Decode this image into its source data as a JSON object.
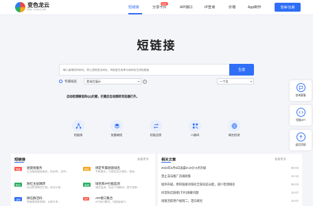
{
  "header": {
    "logo_name": "变色龙云",
    "logo_domain": "BSL.YUN.COM",
    "nav": [
      {
        "label": "短链接",
        "active": true
      },
      {
        "label": "分享卡片",
        "badge": "HOT"
      },
      {
        "label": "API接口"
      },
      {
        "label": "IP查询"
      },
      {
        "label": "价格"
      },
      {
        "label": "App制作"
      }
    ],
    "login_label": "登录/注册"
  },
  "hero": {
    "title": "短链接",
    "search_placeholder": "输入要缩短的网址，禁止违规违法网址，将批量生成单号或网址生成短链接",
    "generate_label": "生成",
    "option_label": "专属域名",
    "select_login_label": "登录后展示",
    "select_duration": "一个月",
    "help": "?",
    "notice": "自动检测微信和QQ拦截，拦截后自动跳转浏览器打开。"
  },
  "features": [
    {
      "label": "短链接",
      "icon": "share-icon"
    },
    {
      "label": "批量缩短",
      "icon": "layers-icon"
    },
    {
      "label": "短链还原",
      "icon": "swap-icon"
    },
    {
      "label": "二维码",
      "icon": "qrcode-icon"
    },
    {
      "label": "域名检测",
      "icon": "globe-icon"
    }
  ],
  "float_bar": [
    {
      "label": "咨询客服",
      "icon": "chat-icon"
    },
    {
      "label": "短链API",
      "icon": "code-icon"
    },
    {
      "label": "返回顶部",
      "icon": "arrow-up-icon"
    }
  ],
  "tools_panel": {
    "title": "短链接",
    "more": "查看更多",
    "items": [
      {
        "tag": "短链",
        "tag_color": "#ff5a4e",
        "title": "短链接服务",
        "desc": "企业级短链接服务，防封杀，支持..."
      },
      {
        "tag": "域名",
        "tag_color": "#f5a623",
        "title": "绑定专属短链域名",
        "desc": "专属域名，可绑定自主域名，提高..."
      },
      {
        "tag": "防封",
        "tag_color": "#27ae60",
        "title": "防红主层跳转",
        "desc": "自动检测微信拦截，安全可靠..."
      },
      {
        "tag": "监测",
        "tag_color": "#27ae60",
        "title": "域名和IP拦截监测",
        "desc": "域名监测，自动下线解封，提升效果..."
      },
      {
        "tag": "活码",
        "tag_color": "#2f6ef6",
        "title": "微信群活码",
        "desc": "突破微信群限制，无需开发..."
      },
      {
        "tag": "API",
        "tag_color": "#ff5a4e",
        "title": "API接口集合",
        "desc": "API接口集合，短链接接口..."
      }
    ]
  },
  "news_panel": {
    "title": "相关文章",
    "more": "查看更多",
    "items": [
      {
        "title": "2024年6月5日凌晨0:10分-6点升级",
        "date": "06-03"
      },
      {
        "title": "禁止非法推广违规政策",
        "date": "12-13"
      },
      {
        "title": "程序升级，原的链接对域名全部动态分配，减少检测域名",
        "date": "06-03"
      },
      {
        "title": "抖音私信链接(卡片)屏蔽问题",
        "date": "10-07"
      },
      {
        "title": "短链活跃用户规则二，定向域名",
        "date": "10-07"
      }
    ]
  }
}
